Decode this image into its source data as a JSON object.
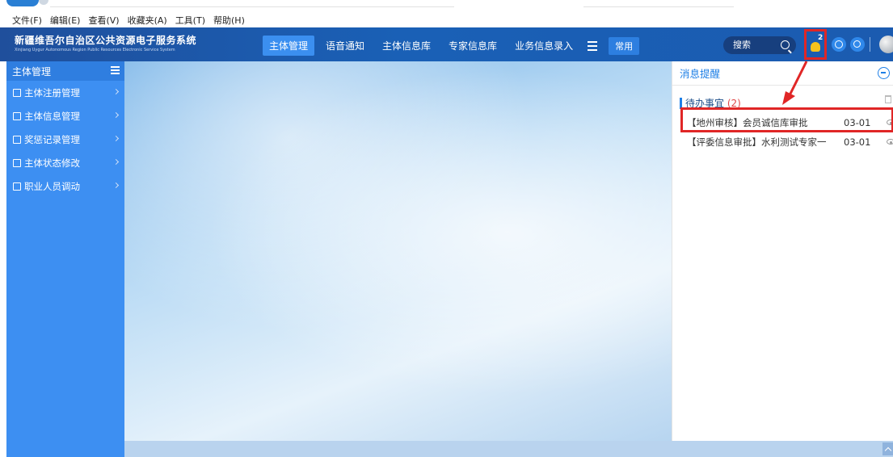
{
  "menubar": {
    "items": [
      "文件(F)",
      "编辑(E)",
      "查看(V)",
      "收藏夹(A)",
      "工具(T)",
      "帮助(H)"
    ]
  },
  "header": {
    "title": "新疆维吾尔自治区公共资源电子服务系统",
    "subtitle": "Xinjiang Uygur Autonomous Region Public Resources Electronic Service System",
    "nav": [
      "主体管理",
      "语音通知",
      "主体信息库",
      "专家信息库",
      "业务信息录入"
    ],
    "nav_active_index": 0,
    "common_button": "常用",
    "search_placeholder": "搜索",
    "notification_badge": "2"
  },
  "sidebar": {
    "title": "主体管理",
    "items": [
      {
        "label": "主体注册管理"
      },
      {
        "label": "主体信息管理"
      },
      {
        "label": "奖惩记录管理"
      },
      {
        "label": "主体状态修改"
      },
      {
        "label": "职业人员调动"
      }
    ]
  },
  "panel": {
    "title": "消息提醒",
    "section_label": "待办事宜",
    "section_count": "(2)",
    "messages": [
      {
        "text": "【地州审核】会员诚信库审批",
        "date": "03-01"
      },
      {
        "text": "【评委信息审批】水利测试专家一",
        "date": "03-01"
      }
    ]
  },
  "colors": {
    "header_bg": "#1a60b6",
    "sidebar_bg": "#3d8ff2",
    "accent": "#1e7fe6",
    "annotation_red": "#e02626"
  }
}
